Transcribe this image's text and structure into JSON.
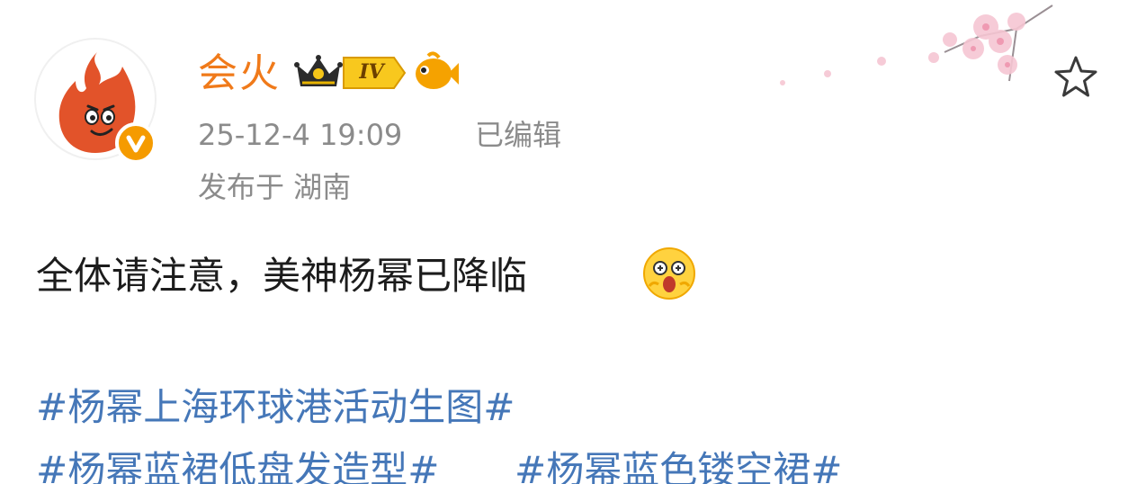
{
  "post": {
    "author": {
      "name": "会火",
      "level": "IV",
      "verified_icon": "verified-v-icon",
      "crown_icon": "crown-icon",
      "badge_icon": "fish-badge-icon"
    },
    "timestamp": "25-12-4 19:09",
    "edited_label": "已编辑",
    "location": "发布于 湖南",
    "text": "全体请注意，美神杨幂已降临",
    "emoji": "excited-face-emoji",
    "hashtags": [
      "#杨幂上海环球港活动生图#",
      "#杨幂蓝裙低盘发造型#",
      "#杨幂蓝色镂空裙#"
    ],
    "favorite_icon": "star-outline-icon"
  },
  "colors": {
    "username": "#f07a1a",
    "meta": "#8b8b8b",
    "text": "#1c1c1c",
    "hashtag": "#4577b8",
    "avatar_fire": "#e2532a",
    "verified": "#f59b00"
  }
}
